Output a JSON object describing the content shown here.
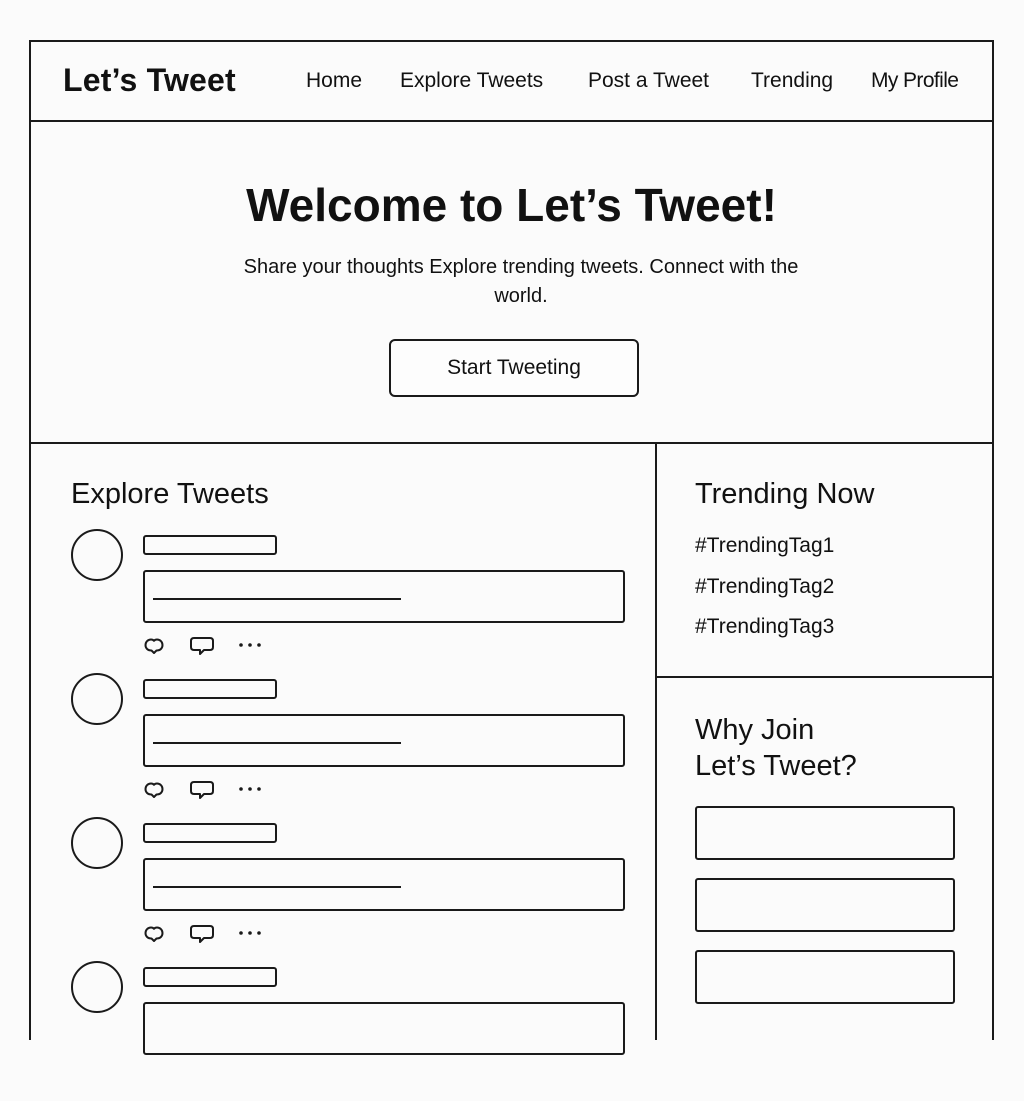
{
  "app": {
    "title": "Let’s Tweet"
  },
  "nav": {
    "items": [
      {
        "label": "Home"
      },
      {
        "label": "Explore Tweets"
      },
      {
        "label": "Post a Tweet"
      },
      {
        "label": "Trending"
      },
      {
        "label": "My Profile"
      }
    ]
  },
  "hero": {
    "title": "Welcome to Let’s Tweet!",
    "subtitle": "Share your thoughts  Explore trending tweets. Connect with the world.",
    "button_label": "Start Tweeting"
  },
  "feed": {
    "title": "Explore Tweets",
    "tweet_count_visible": 4,
    "action_icons": [
      "like-icon",
      "comment-icon",
      "more-icon"
    ]
  },
  "trending": {
    "title": "Trending Now",
    "tags": [
      "#TrendingTag1",
      "#TrendingTag2",
      "#TrendingTag3"
    ]
  },
  "why_join": {
    "title_line1": "Why Join",
    "title_line2": "Let’s Tweet?"
  },
  "colors": {
    "line": "#1a1a1a",
    "background": "#fbfbfb",
    "text": "#111111"
  }
}
